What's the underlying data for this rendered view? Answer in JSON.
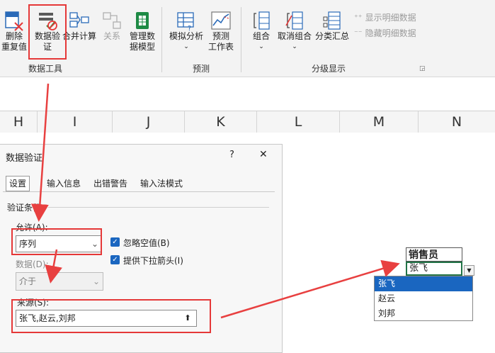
{
  "ribbon": {
    "data_tools": {
      "remove_dup": "删除\n重复值",
      "data_validation": "数据验\n证",
      "consolidate": "合并计算",
      "relations": "关系",
      "manage_model": "管理数\n据模型",
      "group_label": "数据工具"
    },
    "forecast": {
      "what_if": "模拟分析",
      "forecast_sheet": "预测\n工作表",
      "group_label": "预测"
    },
    "outline": {
      "group": "组合",
      "ungroup": "取消组合",
      "subtotal": "分类汇总",
      "show_detail": "显示明细数据",
      "hide_detail": "隐藏明细数据",
      "group_label": "分级显示"
    }
  },
  "columns": [
    "H",
    "I",
    "J",
    "K",
    "L",
    "M",
    "N"
  ],
  "dialog": {
    "title": "数据验证",
    "help": "?",
    "close": "✕",
    "tabs": [
      "设置",
      "输入信息",
      "出错警告",
      "输入法模式"
    ],
    "section_title": "验证条件",
    "allow_label": "允许(A):",
    "allow_value": "序列",
    "ignore_blank": "忽略空值(B)",
    "dropdown_arrow": "提供下拉箭头(I)",
    "data_label": "数据(D):",
    "data_value": "介于",
    "source_label": "来源(S):",
    "source_value": "张飞,赵云,刘邦"
  },
  "sheet": {
    "header_cell": "销售员",
    "active_cell": "张飞",
    "dropdown_items": [
      "张飞",
      "赵云",
      "刘邦"
    ],
    "selected_index": 0
  },
  "colors": {
    "highlight": "#e53838",
    "accent": "#1a66c0",
    "arrow": "#e84040"
  },
  "icons": [
    "remove-duplicates-icon",
    "data-validation-icon",
    "consolidate-icon",
    "relations-icon",
    "manage-model-icon",
    "what-if-icon",
    "forecast-sheet-icon",
    "group-icon",
    "ungroup-icon",
    "subtotal-icon",
    "show-detail-icon",
    "hide-detail-icon",
    "upload-icon",
    "chevron-down-icon",
    "check-icon",
    "close-icon"
  ]
}
